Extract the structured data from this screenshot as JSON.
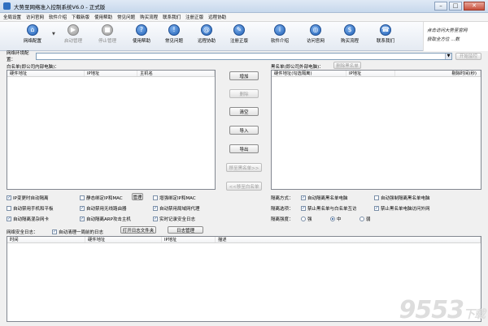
{
  "window": {
    "title": "大势至网络准入控制系统V6.0 - 正式版"
  },
  "menu": [
    "全局设置",
    "访问官网",
    "软件介绍",
    "下载新版",
    "使用帮助",
    "常见问题",
    "购买流程",
    "联系我们",
    "注册正版",
    "远程协助"
  ],
  "toolbar": {
    "buttons": [
      {
        "label": "网络配置",
        "icon": "⌂",
        "disabled": false
      },
      {
        "label": "启动管理",
        "icon": "▶",
        "disabled": true
      },
      {
        "label": "停止管理",
        "icon": "■",
        "disabled": true
      },
      {
        "label": "使用帮助",
        "icon": "?",
        "disabled": false
      },
      {
        "label": "常见问题",
        "icon": "!",
        "disabled": false
      },
      {
        "label": "远程协助",
        "icon": "@",
        "disabled": false
      },
      {
        "label": "注册正版",
        "icon": "✎",
        "disabled": false
      },
      {
        "label": "软件介绍",
        "icon": "i",
        "disabled": false
      },
      {
        "label": "访问官网",
        "icon": "◎",
        "disabled": false
      },
      {
        "label": "购买流程",
        "icon": "$",
        "disabled": false
      },
      {
        "label": "联系我们",
        "icon": "☎",
        "disabled": false
      }
    ],
    "promo_line1": "点击访问大势至官网",
    "promo_line2": "获取全方位 ...数"
  },
  "env": {
    "label": "网络环境配置：",
    "value": "",
    "test_button": "开始监控"
  },
  "whitelist": {
    "title": "白名单(即公司内部电脑)：",
    "columns": [
      "硬件地址",
      "IP地址",
      "主机名"
    ]
  },
  "blacklist": {
    "title": "黑名单(即公司外部电脑)：",
    "delete_button": "删除黑名单",
    "columns": [
      "硬件地址(勾选隔离)",
      "IP地址",
      "剔除时间(秒)"
    ]
  },
  "middle_buttons": {
    "add": "增加",
    "delete": "删除",
    "clear": "清空",
    "import": "导入",
    "export": "导出",
    "to_black": "移至黑名单>>",
    "to_white": "<<移至白名单"
  },
  "options_left": [
    {
      "label": "IP变更时自动隔离",
      "checked": true
    },
    {
      "label": "静态绑定IP和MAC",
      "checked": false,
      "button": "管理"
    },
    {
      "label": "增强绑定IP和MAC",
      "checked": false
    },
    {
      "label": "自动禁用手机和平板",
      "checked": false
    },
    {
      "label": "自动禁用无线路由器",
      "checked": true
    },
    {
      "label": "自动禁用局域网代理",
      "checked": true
    },
    {
      "label": "自动隔离混杂网卡",
      "checked": true
    },
    {
      "label": "自动隔离ARP攻击主机",
      "checked": true
    },
    {
      "label": "实时记录安全日志",
      "checked": true
    }
  ],
  "options_right": {
    "mode_label": "隔离方式：",
    "mode_options": [
      {
        "label": "自动隔离黑名单电脑",
        "checked": true
      },
      {
        "label": "自动强制隔离黑名单电脑",
        "checked": false
      }
    ],
    "scope_label": "隔离选项：",
    "scope_options": [
      {
        "label": "禁止黑名单与白名单互访",
        "checked": true
      },
      {
        "label": "禁止黑名单电脑访问外网",
        "checked": true
      }
    ],
    "strength_label": "隔离强度：",
    "strength_options": [
      {
        "label": "强",
        "selected": false
      },
      {
        "label": "中",
        "selected": true
      },
      {
        "label": "弱",
        "selected": false
      }
    ]
  },
  "log": {
    "title": "网络安全日志：",
    "auto_clear": "自动清理一周前的日志",
    "auto_clear_checked": true,
    "open_folder_button": "打开日志文件夹",
    "manage_button": "日志管理",
    "columns": [
      "时间",
      "硬件地址",
      "IP地址",
      "描述"
    ]
  },
  "watermark": {
    "main": "9553",
    "sub": "下载"
  }
}
